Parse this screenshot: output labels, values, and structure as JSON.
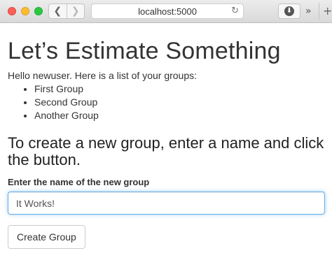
{
  "browser": {
    "url": "localhost:5000",
    "back_glyph": "❮",
    "forward_glyph": "❯",
    "reload_glyph": "↻",
    "download_glyph": "⬇",
    "more_glyph": "»",
    "newtab_glyph": "+"
  },
  "page": {
    "title": "Let’s Estimate Something",
    "intro": "Hello newuser. Here is a list of your groups:",
    "groups": [
      "First Group",
      "Second Group",
      "Another Group"
    ],
    "subtitle": "To create a new group, enter a name and click the button.",
    "field_label": "Enter the name of the new group",
    "field_value": "It Works!",
    "button_label": "Create Group"
  },
  "colors": {
    "focus_border": "#66afe9",
    "traffic_red": "#fc5f57",
    "traffic_yellow": "#fdbc2e",
    "traffic_green": "#29c940"
  }
}
